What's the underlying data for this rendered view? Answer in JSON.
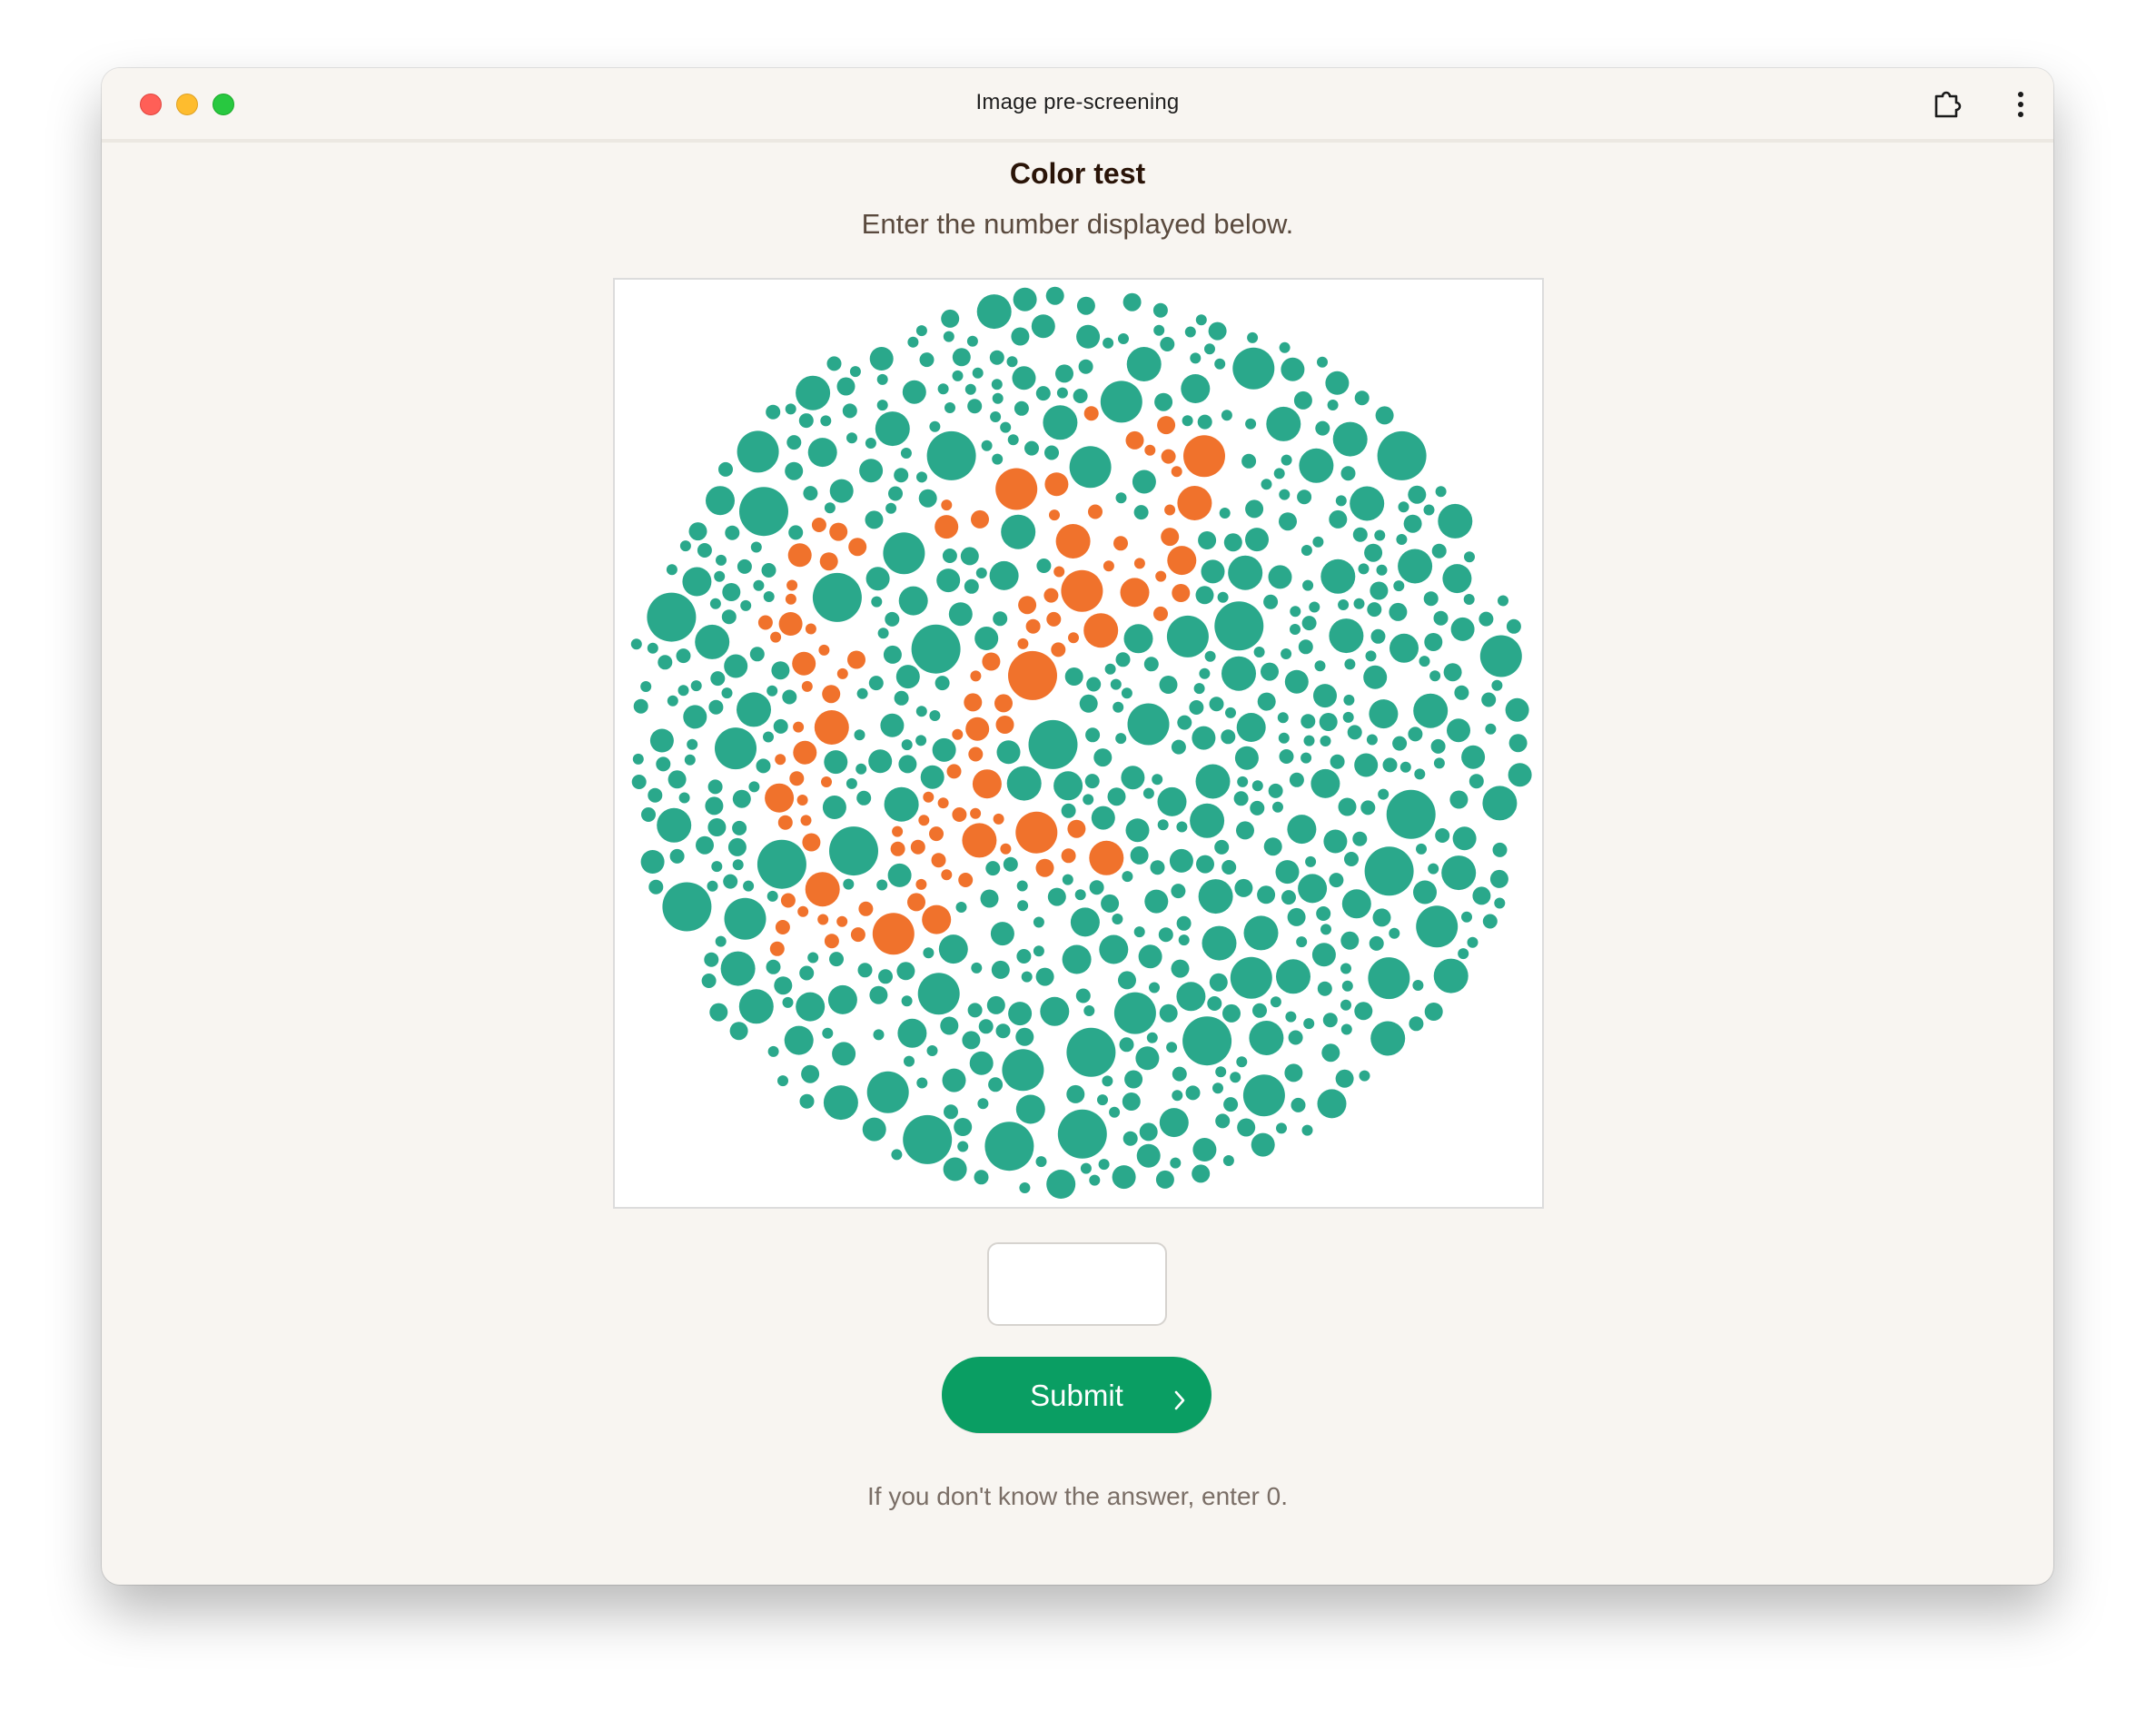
{
  "window": {
    "title": "Image pre-screening"
  },
  "test": {
    "heading": "Color test",
    "instruction": "Enter the number displayed below.",
    "answer_value": "",
    "submit_label": "Submit",
    "hint": "If you don't know the answer, enter 0."
  },
  "plate": {
    "dot_color_background": "#2aa88b",
    "dot_color_figure": "#f0722c"
  },
  "icons": {
    "extension": "puzzle-extension-icon",
    "menu": "vertical-dots-menu-icon",
    "submit": "chevron-right-icon"
  }
}
